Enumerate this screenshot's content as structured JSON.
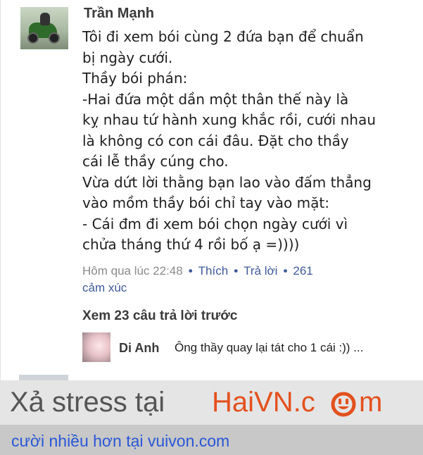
{
  "post": {
    "author": "Trần Mạnh",
    "lines": [
      "Tôi đi xem bói cùng 2 đứa bạn để chuẩn",
      "bị ngày cưới.",
      "Thầy bói phán:",
      "-Hai đứa một dần một thân thế này là",
      "kỵ nhau tứ hành xung khắc rồi, cưới nhau",
      "là không có con cái đâu. Đặt cho thầy",
      "cái lễ thầy cúng cho.",
      "Vừa dứt lời thằng bạn lao vào đấm thẳng",
      "vào mồm thầy bói chỉ tay vào mặt:",
      "- Cái đm đi xem bói chọn ngày  cưới vì",
      "chửa tháng thứ 4 rồi bố ạ =))))"
    ],
    "timestamp": "Hôm qua lúc 22:48",
    "like_label": "Thích",
    "reply_label": "Trả lời",
    "reaction_count": "261",
    "reaction_label": "cảm xúc"
  },
  "comments": {
    "view_previous": "Xem 23 câu trả lời trước",
    "reply": {
      "name": "Di Anh",
      "text": "Ông thầy quay lại tát cho 1 cái :)) ..."
    }
  },
  "banners": {
    "stress_text": "Xả stress tại",
    "brand_part1": "HaiVN.c",
    "brand_part2": "m",
    "bottom_text": "cười nhiều hơn tại vuivon.com"
  },
  "colors": {
    "link_blue": "#3f5b98",
    "brand_orange": "#e3511e",
    "bottom_link": "#2957d6"
  }
}
